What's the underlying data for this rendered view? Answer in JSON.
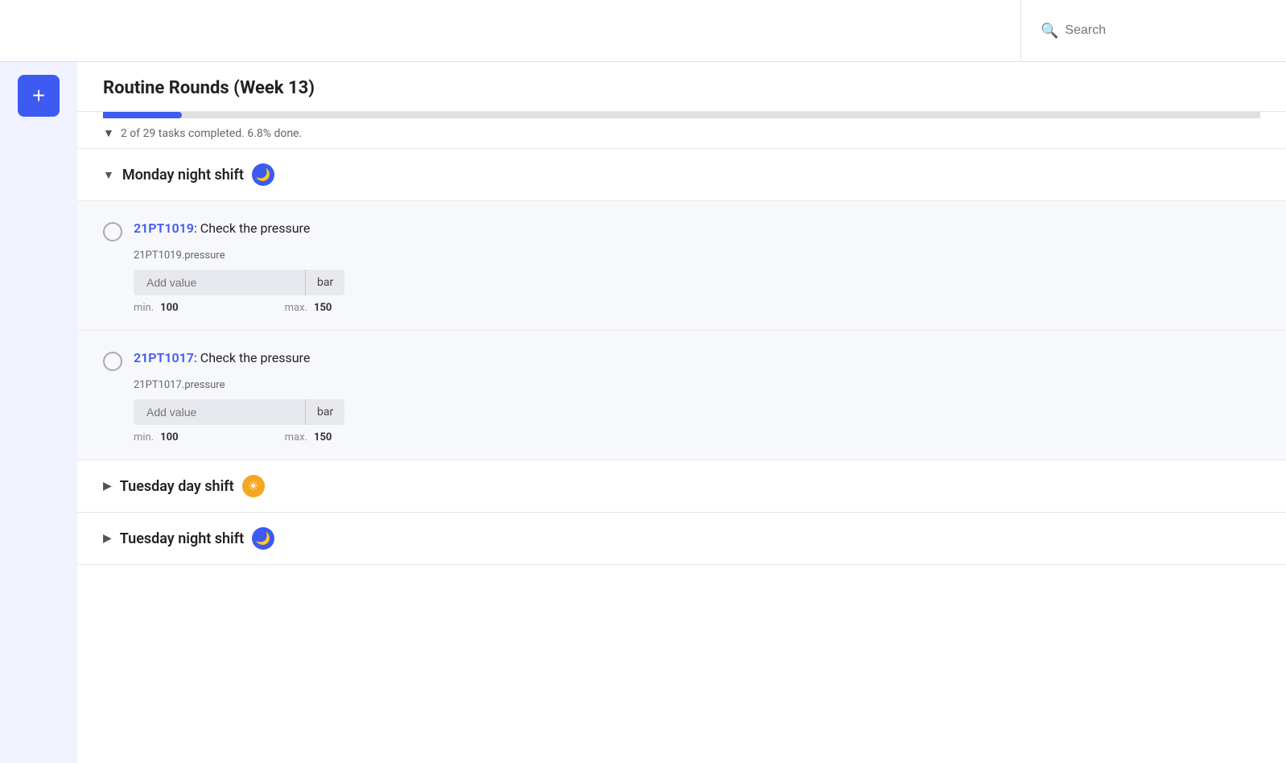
{
  "topbar": {
    "search_placeholder": "Search"
  },
  "sidebar": {
    "add_label": "+"
  },
  "page": {
    "title": "Routine Rounds (Week 13)"
  },
  "progress": {
    "completed": 2,
    "total": 29,
    "percent": 6.8,
    "text": "2 of 29 tasks completed. 6.8% done.",
    "bar_width": "6.8%"
  },
  "sections": [
    {
      "id": "monday-night",
      "title": "Monday night shift",
      "icon_type": "night",
      "icon_symbol": "☽",
      "expanded": true,
      "tasks": [
        {
          "id": "21PT1019",
          "description": ": Check the pressure",
          "tag": "21PT1019.pressure",
          "placeholder": "Add value",
          "unit": "bar",
          "min": 100,
          "max": 150,
          "min_label": "min.",
          "max_label": "max."
        },
        {
          "id": "21PT1017",
          "description": ": Check the pressure",
          "tag": "21PT1017.pressure",
          "placeholder": "Add value",
          "unit": "bar",
          "min": 100,
          "max": 150,
          "min_label": "min.",
          "max_label": "max."
        }
      ]
    }
  ],
  "collapsed_sections": [
    {
      "id": "tuesday-day",
      "title": "Tuesday day shift",
      "icon_type": "day",
      "icon_symbol": "☀"
    },
    {
      "id": "tuesday-night",
      "title": "Tuesday night shift",
      "icon_type": "night",
      "icon_symbol": "☽"
    }
  ]
}
